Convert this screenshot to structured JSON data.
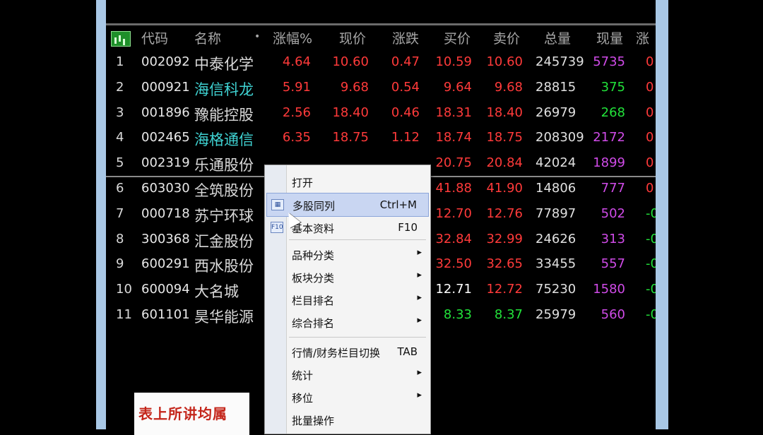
{
  "table": {
    "headers": [
      "代码",
      "名称",
      "•",
      "涨幅%",
      "现价",
      "涨跌",
      "买价",
      "卖价",
      "总量",
      "现量",
      "涨"
    ],
    "rows": [
      {
        "idx": "1",
        "code": "002092",
        "name": "中泰化学",
        "pct": "4.64",
        "price": "10.60",
        "chg": "0.47",
        "bid": "10.59",
        "ask": "10.60",
        "vol": "245739",
        "cur": "5735",
        "edge": "0"
      },
      {
        "idx": "2",
        "code": "000921",
        "name": "海信科龙",
        "pct": "5.91",
        "price": "9.68",
        "chg": "0.54",
        "bid": "9.64",
        "ask": "9.68",
        "vol": "28815",
        "cur": "375",
        "edge": "0"
      },
      {
        "idx": "3",
        "code": "001896",
        "name": "豫能控股",
        "pct": "2.56",
        "price": "18.40",
        "chg": "0.46",
        "bid": "18.31",
        "ask": "18.40",
        "vol": "26979",
        "cur": "268",
        "edge": "0"
      },
      {
        "idx": "4",
        "code": "002465",
        "name": "海格通信",
        "pct": "6.35",
        "price": "18.75",
        "chg": "1.12",
        "bid": "18.74",
        "ask": "18.75",
        "vol": "208309",
        "cur": "2172",
        "edge": "0"
      },
      {
        "idx": "5",
        "code": "002319",
        "name": "乐通股份",
        "pct": "",
        "price": "",
        "chg": "",
        "bid": "20.75",
        "ask": "20.84",
        "vol": "42024",
        "cur": "1899",
        "edge": "0"
      },
      {
        "idx": "6",
        "code": "603030",
        "name": "全筑股份",
        "pct": "",
        "price": "",
        "chg": "",
        "bid": "41.88",
        "ask": "41.90",
        "vol": "14806",
        "cur": "777",
        "edge": "0"
      },
      {
        "idx": "7",
        "code": "000718",
        "name": "苏宁环球",
        "pct": "",
        "price": "",
        "chg": "",
        "bid": "12.70",
        "ask": "12.76",
        "vol": "77897",
        "cur": "502",
        "edge": "-0"
      },
      {
        "idx": "8",
        "code": "300368",
        "name": "汇金股份",
        "pct": "",
        "price": "",
        "chg": "",
        "bid": "32.84",
        "ask": "32.99",
        "vol": "24626",
        "cur": "313",
        "edge": "-0"
      },
      {
        "idx": "9",
        "code": "600291",
        "name": "西水股份",
        "pct": "",
        "price": "",
        "chg": "",
        "bid": "32.50",
        "ask": "32.65",
        "vol": "33455",
        "cur": "557",
        "edge": "-0"
      },
      {
        "idx": "10",
        "code": "600094",
        "name": "大名城",
        "pct": "",
        "price": "",
        "chg": "",
        "bid": "12.71",
        "ask": "12.72",
        "vol": "75230",
        "cur": "1580",
        "edge": "-0"
      },
      {
        "idx": "11",
        "code": "601101",
        "name": "昊华能源",
        "pct": "",
        "price": "",
        "chg": "",
        "bid": "8.33",
        "ask": "8.37",
        "vol": "25979",
        "cur": "560",
        "edge": "-0"
      }
    ]
  },
  "context_menu": {
    "items": [
      {
        "label": "打开",
        "shortcut": "",
        "arrow": ""
      },
      {
        "label": "多股同列",
        "shortcut": "Ctrl+M",
        "arrow": "",
        "icon": "grid-icon",
        "icon_glyph": "▦"
      },
      {
        "label": "基本资料",
        "shortcut": "F10",
        "arrow": "",
        "icon": "f10-info-icon",
        "icon_glyph": "F10"
      },
      {
        "label": "品种分类",
        "shortcut": "",
        "arrow": "▸"
      },
      {
        "label": "板块分类",
        "shortcut": "",
        "arrow": "▸"
      },
      {
        "label": "栏目排名",
        "shortcut": "",
        "arrow": "▸"
      },
      {
        "label": "综合排名",
        "shortcut": "",
        "arrow": "▸"
      },
      {
        "label": "行情/财务栏目切换",
        "shortcut": "TAB",
        "arrow": ""
      },
      {
        "label": "统计",
        "shortcut": "",
        "arrow": "▸"
      },
      {
        "label": "移位",
        "shortcut": "",
        "arrow": "▸"
      },
      {
        "label": "批量操作",
        "shortcut": "",
        "arrow": ""
      }
    ]
  },
  "note": {
    "text": "表上所讲均属"
  },
  "colors": {
    "background": "#000000",
    "window_frame": "#a9c8e6",
    "rise_red": "#ff3a3a",
    "fall_green": "#22e23a",
    "highlight_cyan": "#3fd2d2",
    "volume_magenta": "#d04be8",
    "menu_highlight": "#c9d6f2",
    "note_red": "#c4251a"
  }
}
